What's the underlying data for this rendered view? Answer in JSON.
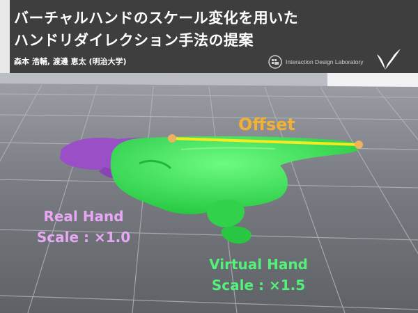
{
  "header": {
    "title_line_1": "バーチャルハンドのスケール変化を用いた",
    "title_line_2": "ハンドリダイレクション手法の提案",
    "authors": "森本 浩輔,  渡邊 恵太 (明治大学)",
    "lab_name": "Interaction Design Laboratory"
  },
  "scene": {
    "offset_label": "Offset",
    "real_hand": {
      "name": "Real Hand",
      "scale": "Scale : ×1.0"
    },
    "virtual_hand": {
      "name": "Virtual Hand",
      "scale": "Scale : ×1.5"
    }
  },
  "colors": {
    "header_bg": "#3e3e3e",
    "floor": "#6f7278",
    "real_hand": "#9a4fc7",
    "virtual_hand": "#33e04d",
    "offset_line": "#f5ea20",
    "offset_point": "#f0b060",
    "offset_text": "#f2b134"
  }
}
